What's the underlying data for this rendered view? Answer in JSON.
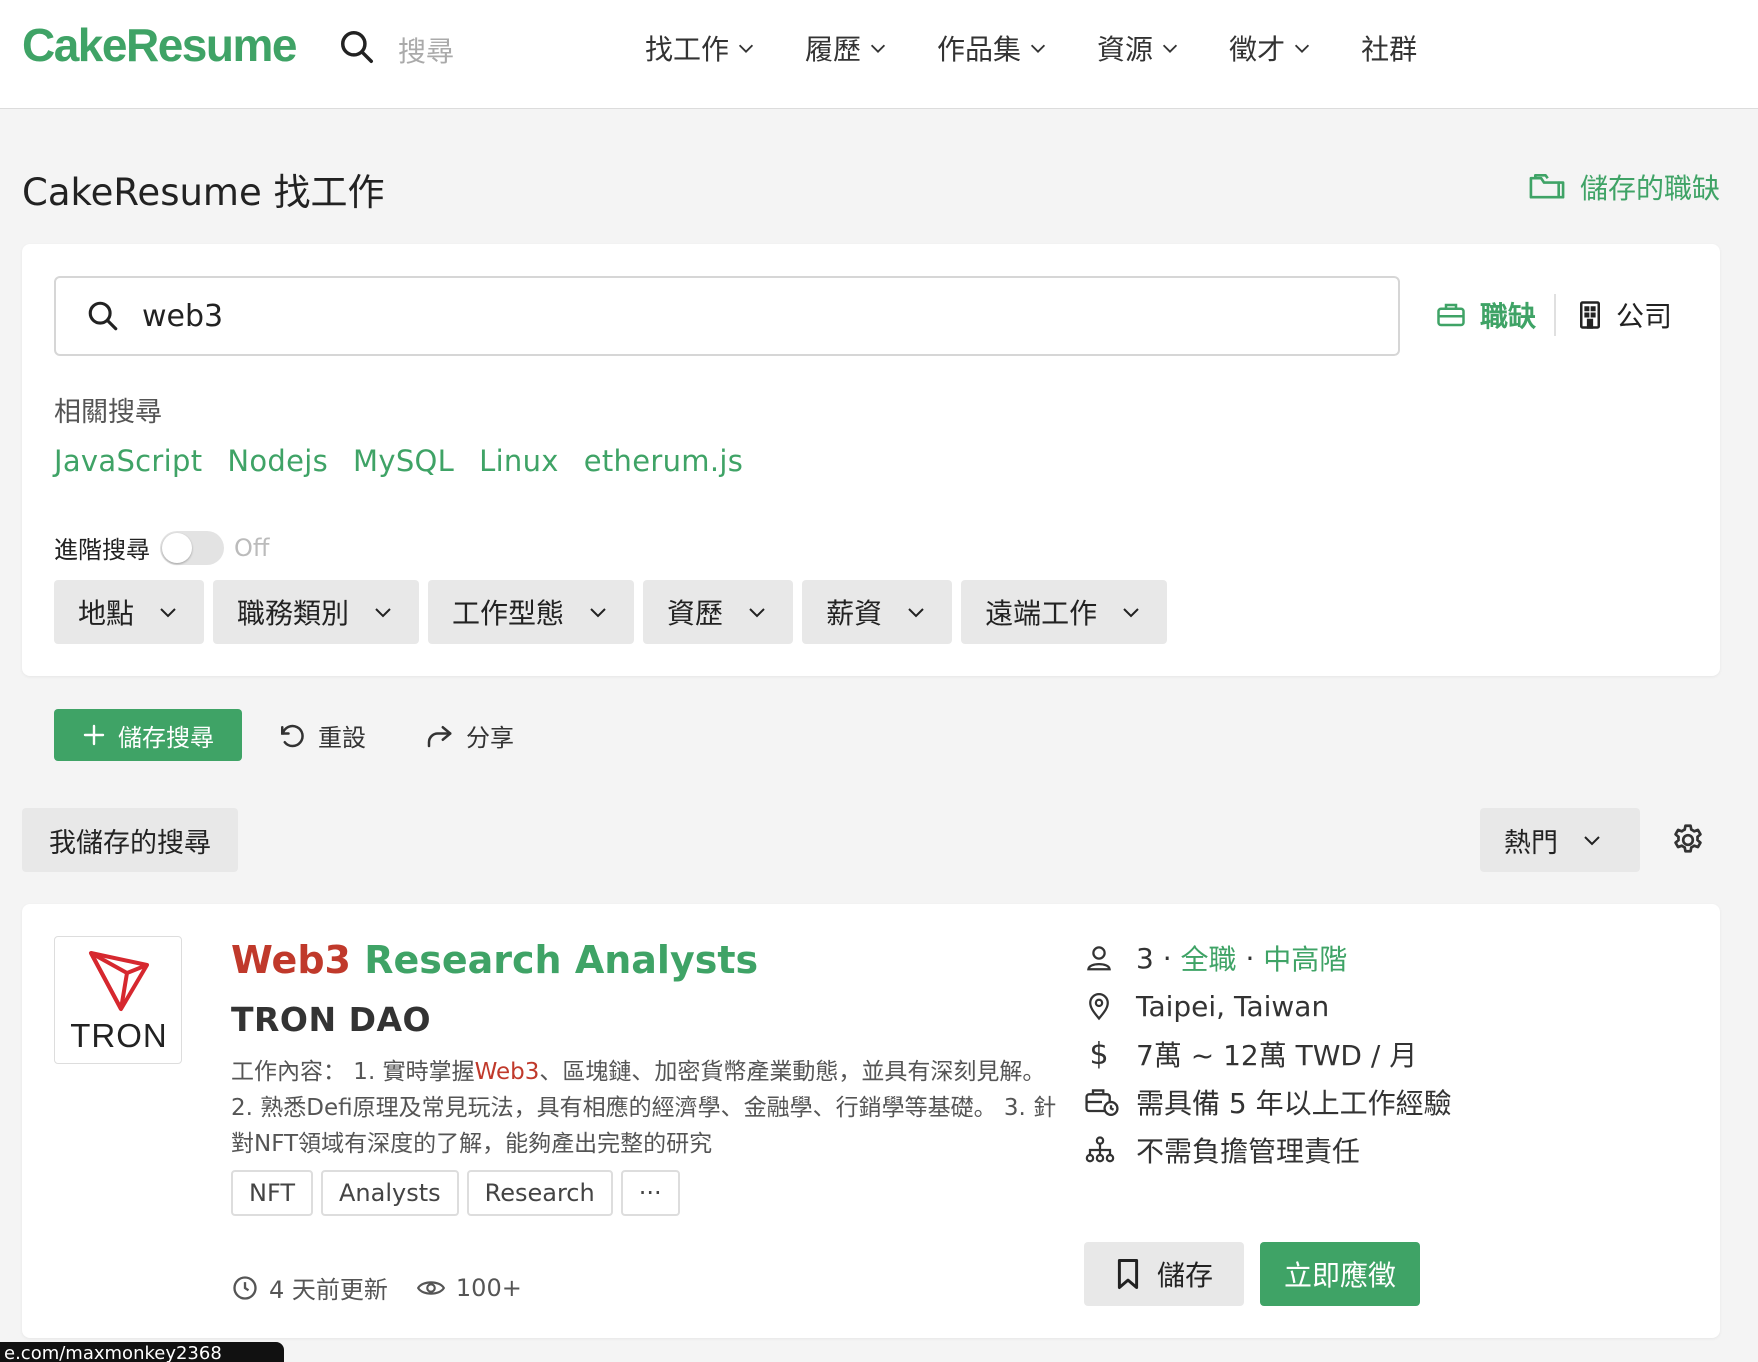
{
  "header": {
    "logo": "CakeResume",
    "search_placeholder": "搜尋",
    "nav": [
      {
        "label": "找工作"
      },
      {
        "label": "履歷"
      },
      {
        "label": "作品集"
      },
      {
        "label": "資源"
      },
      {
        "label": "徵才"
      },
      {
        "label": "社群"
      }
    ]
  },
  "page": {
    "title": "CakeResume 找工作",
    "saved_jobs_label": "儲存的職缺"
  },
  "search": {
    "query": "web3",
    "tabs": {
      "jobs": "職缺",
      "companies": "公司"
    },
    "related_label": "相關搜尋",
    "related": [
      "JavaScript",
      "Nodejs",
      "MySQL",
      "Linux",
      "etherum.js"
    ],
    "advanced_label": "進階搜尋",
    "advanced_state": "Off",
    "filters": [
      "地點",
      "職務類別",
      "工作型態",
      "資歷",
      "薪資",
      "遠端工作"
    ]
  },
  "actions": {
    "save_search": "儲存搜尋",
    "reset": "重設",
    "share": "分享",
    "my_saved_searches": "我儲存的搜尋",
    "sort": "熱門"
  },
  "job": {
    "logo_text": "TRON",
    "title_highlight": "Web3",
    "title_rest": " Research Analysts",
    "company": "TRON DAO",
    "desc_prefix": "工作內容： 1. 實時掌握",
    "desc_highlight": "Web3",
    "desc_rest": "、區塊鏈、加密貨幣產業動態，並具有深刻見解。 2. 熟悉Defi原理及常見玩法，具有相應的經濟學、金融學、行銷學等基礎。 3. 針對NFT領域有深度的了解，能夠產出完整的研究",
    "tags": [
      "NFT",
      "Analysts",
      "Research",
      "···"
    ],
    "updated": "4 天前更新",
    "views": "100+",
    "openings": "3",
    "employment_type": "全職",
    "seniority": "中高階",
    "location": "Taipei, Taiwan",
    "salary": "7萬 ~ 12萬 TWD / 月",
    "experience": "需具備 5 年以上工作經驗",
    "management": "不需負擔管理責任",
    "save_label": "儲存",
    "apply_label": "立即應徵"
  },
  "status_bar": {
    "url": "e.com/maxmonkey2368"
  },
  "colors": {
    "brand": "#3fa366",
    "highlight": "#c0392b"
  }
}
